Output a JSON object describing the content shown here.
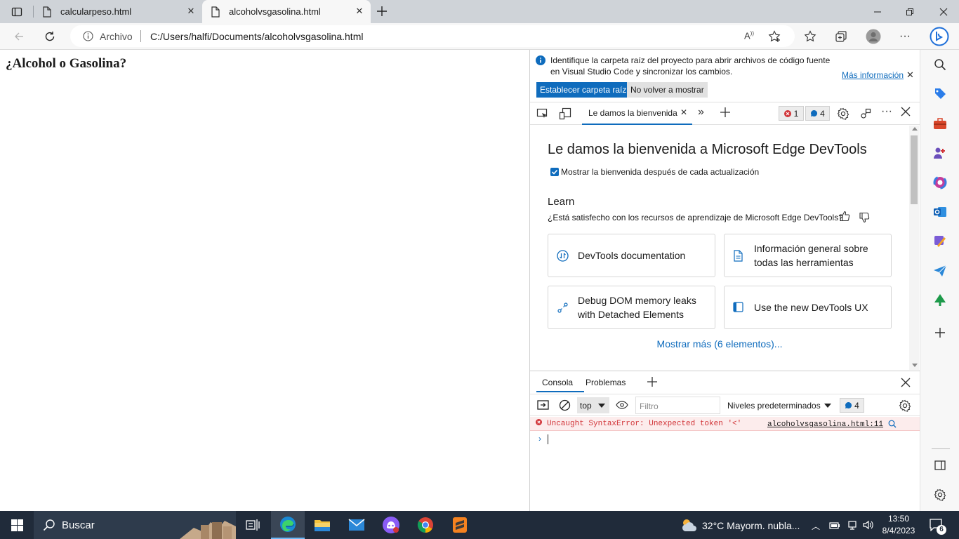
{
  "tabs": [
    {
      "label": "calcularpeso.html"
    },
    {
      "label": "alcoholvsgasolina.html"
    }
  ],
  "address": {
    "scheme_label": "Archivo",
    "url": "C:/Users/halfi/Documents/alcoholvsgasolina.html"
  },
  "page": {
    "heading": "¿Alcohol o Gasolina?"
  },
  "devtools": {
    "info": {
      "message_line1": "Identifique la carpeta raíz del proyecto para abrir archivos de código fuente",
      "message_line2": "en Visual Studio Code y sincronizar los cambios.",
      "more_info": "Más información",
      "primary_button": "Establecer carpeta raíz",
      "secondary_button": "No volver a mostrar"
    },
    "toolbar": {
      "active_tab": "Le damos la bienvenida",
      "errors_count": "1",
      "messages_count": "4"
    },
    "welcome": {
      "title": "Le damos la bienvenida a Microsoft Edge DevTools",
      "checkbox_label": "Mostrar la bienvenida después de cada actualización",
      "learn_heading": "Learn",
      "learn_question": "¿Está satisfecho con los recursos de aprendizaje de Microsoft Edge DevTools?",
      "cards": [
        {
          "line1": "DevTools documentation",
          "line2": ""
        },
        {
          "line1": "Información general sobre",
          "line2": "todas las herramientas"
        },
        {
          "line1": "Debug DOM memory leaks",
          "line2": "with Detached Elements"
        },
        {
          "line1": "Use the new DevTools UX",
          "line2": ""
        }
      ],
      "show_more": "Mostrar más (6 elementos)..."
    },
    "drawer": {
      "tabs": [
        "Consola",
        "Problemas"
      ],
      "context": "top",
      "filter_placeholder": "Filtro",
      "levels": "Niveles predeterminados",
      "messages_count": "4",
      "error_message": "Uncaught SyntaxError: Unexpected token '<'",
      "error_source": "alcoholvsgasolina.html:11"
    }
  },
  "taskbar": {
    "search_label": "Buscar",
    "weather": "32°C  Mayorm. nubla...",
    "time": "13:50",
    "date": "8/4/2023",
    "notification_count": "6"
  },
  "colors": {
    "accent": "#0f6cbd",
    "error": "#d13438",
    "taskbar": "#202b3a"
  }
}
